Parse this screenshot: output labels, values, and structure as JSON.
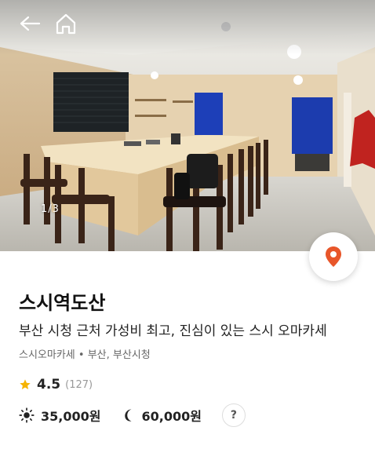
{
  "hero": {
    "image_counter": "1/3"
  },
  "nav": {
    "back_icon": "back-arrow-icon",
    "home_icon": "home-icon"
  },
  "location_button": {
    "icon": "map-pin-icon",
    "color": "#E8562A"
  },
  "restaurant": {
    "name": "스시역도산",
    "description": "부산 시청 근처 가성비 최고, 진심이 있는 스시 오마카세",
    "category_location": "스시오마카세 • 부산, 부산시청",
    "rating": "4.5",
    "review_count": "(127)",
    "lunch_price": "35,000원",
    "dinner_price": "60,000원",
    "help_label": "?"
  },
  "colors": {
    "star": "#F5B301",
    "pin": "#E8562A"
  }
}
